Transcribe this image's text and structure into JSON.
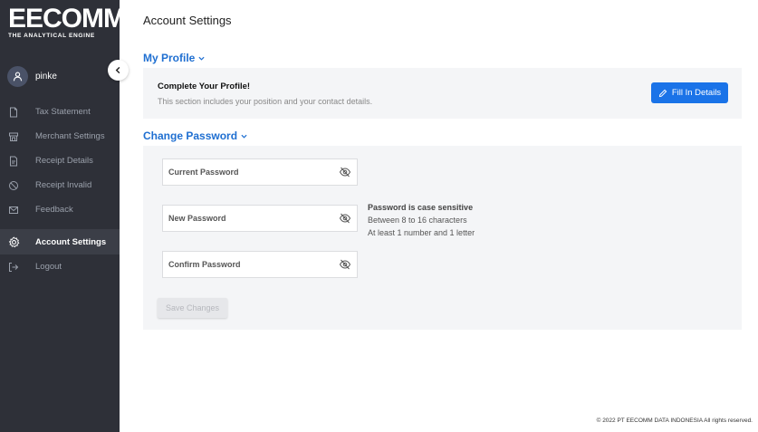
{
  "brand": {
    "logo_text": "EECOMM",
    "tagline": "THE ANALYTICAL ENGINE"
  },
  "user": {
    "name": "pinke"
  },
  "sidebar": {
    "items": [
      {
        "label": "Tax Statement",
        "icon": "document-icon"
      },
      {
        "label": "Merchant Settings",
        "icon": "store-icon"
      },
      {
        "label": "Receipt Details",
        "icon": "receipt-icon"
      },
      {
        "label": "Receipt Invalid",
        "icon": "block-icon"
      },
      {
        "label": "Feedback",
        "icon": "mail-icon"
      },
      {
        "label": "Account Settings",
        "icon": "gear-icon",
        "active": true
      },
      {
        "label": "Logout",
        "icon": "logout-icon"
      }
    ]
  },
  "page": {
    "title": "Account Settings"
  },
  "profile": {
    "section_title": "My Profile",
    "heading": "Complete Your Profile!",
    "description": "This section includes your position and your contact details.",
    "fill_button": "Fill In Details"
  },
  "password": {
    "section_title": "Change Password",
    "current_label": "Current Password",
    "new_label": "New Password",
    "confirm_label": "Confirm Password",
    "rules_heading": "Password is case sensitive",
    "rule_1": "Between 8 to 16 characters",
    "rule_2": "At least 1 number and 1 letter",
    "save_button": "Save Changes"
  },
  "footer": {
    "copyright": "© 2022 PT EECOMM DATA INDONESIA All rights reserved."
  },
  "colors": {
    "sidebar_bg": "#2e3038",
    "accent": "#1a73e8",
    "panel_bg": "#f4f5f7"
  }
}
